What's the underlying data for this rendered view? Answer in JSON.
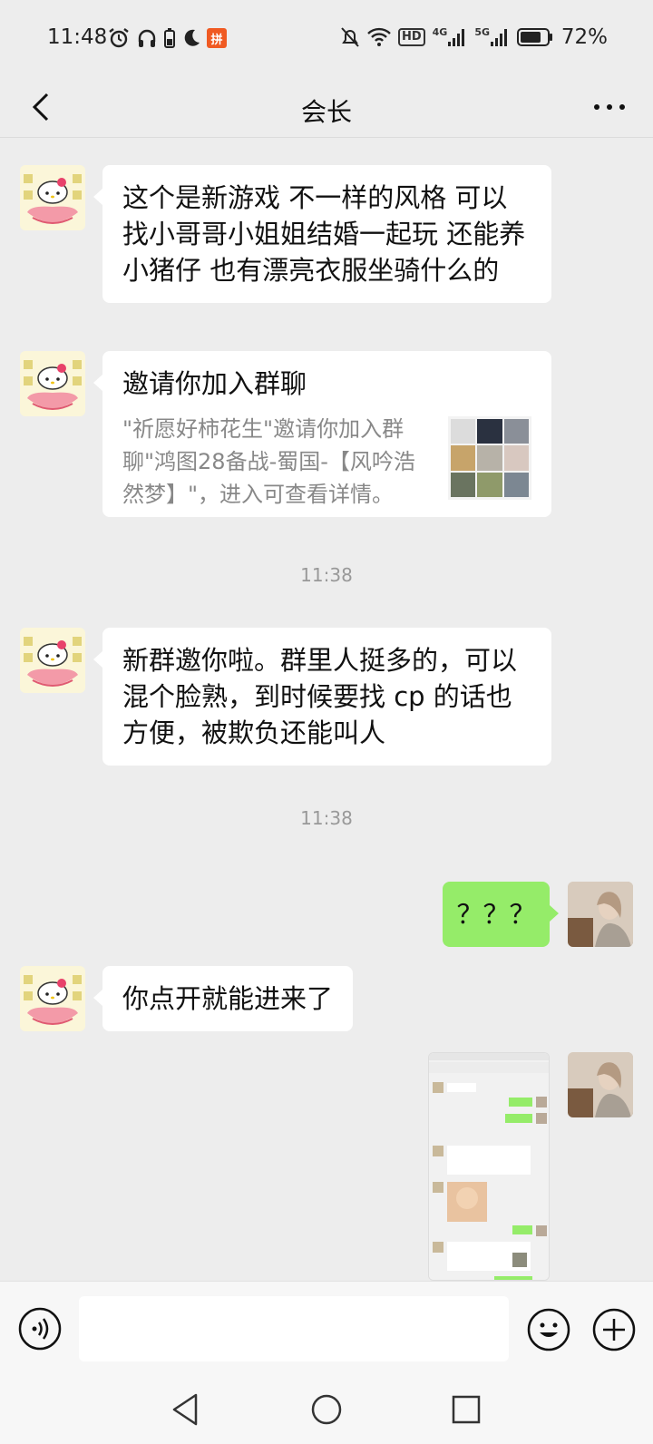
{
  "status_bar": {
    "time": "11:48",
    "battery_percent": "72%",
    "shop_badge": "拼",
    "hd_label": "HD",
    "net_4g": "4G",
    "net_5g": "5G",
    "icons_left": [
      "alarm-icon",
      "headphones-icon",
      "battery-saver-icon",
      "moon-icon",
      "shop-app-icon"
    ],
    "icons_right": [
      "mute-icon",
      "wifi-icon",
      "hd-icon",
      "signal-4g-icon",
      "signal-5g-icon",
      "battery-icon"
    ]
  },
  "nav": {
    "title": "会长",
    "back_icon": "back-arrow-icon",
    "more_icon": "more-dots-icon"
  },
  "messages": [
    {
      "side": "left",
      "type": "text",
      "text": "这个是新游戏 不一样的风格 可以找小哥哥小姐姐结婚一起玩 还能养小猪仔 也有漂亮衣服坐骑什么的"
    },
    {
      "side": "left",
      "type": "card",
      "title": "邀请你加入群聊",
      "description": "\"祈愿好柿花生\"邀请你加入群聊\"鸿图28备战-蜀国-【风吟浩然梦】\"，进入可查看详情。"
    },
    {
      "type": "time",
      "text": "11:38"
    },
    {
      "side": "left",
      "type": "text",
      "text": "新群邀你啦。群里人挺多的，可以混个脸熟，到时候要找 cp 的话也方便，被欺负还能叫人"
    },
    {
      "type": "time",
      "text": "11:38"
    },
    {
      "side": "right",
      "type": "text",
      "text": "？？？"
    },
    {
      "side": "left",
      "type": "text",
      "text": "你点开就能进来了"
    },
    {
      "side": "right",
      "type": "image",
      "image_label": "screenshot"
    }
  ],
  "input_bar": {
    "placeholder": "",
    "voice_icon": "voice-icon",
    "emoji_icon": "emoji-icon",
    "plus_icon": "plus-icon"
  },
  "system_nav": [
    "back-triangle-icon",
    "home-circle-icon",
    "recents-square-icon"
  ],
  "colors": {
    "background": "#ededed",
    "bubble_left": "#ffffff",
    "bubble_right": "#95ec69",
    "timestamp": "#999999",
    "card_description": "#888888"
  }
}
